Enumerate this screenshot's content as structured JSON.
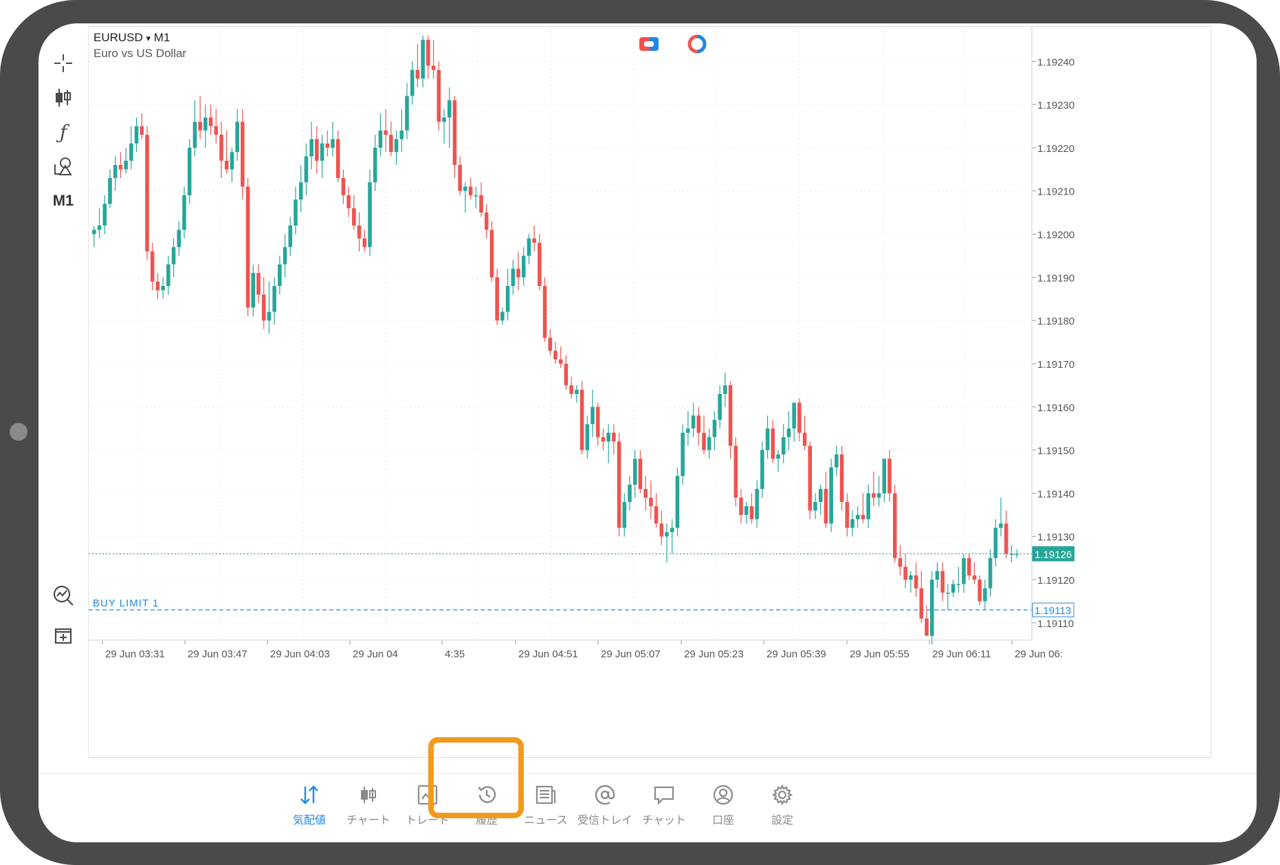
{
  "symbol": {
    "name": "EURUSD",
    "dropdown": "▾",
    "timeframe": "M1",
    "description": "Euro vs US Dollar"
  },
  "left_toolbar": {
    "crosshair": "crosshair-icon",
    "chart_type": "candlestick-icon",
    "indicators": "function-icon",
    "objects": "shapes-icon",
    "timeframe_label": "M1",
    "trade_chart": "trade-chart-icon",
    "add_indicator": "add-window-icon"
  },
  "colors": {
    "bull": "#26a69a",
    "bear": "#ef5350",
    "price_line": "#26a69a",
    "buy_limit": "#1e88e5",
    "accent": "#1e88e5",
    "highlight": "#f39a1c"
  },
  "price_labels": {
    "current": "1.19126",
    "buy_limit": "1.19113",
    "buy_limit_text": "BUY LIMIT 1"
  },
  "y_axis": [
    "1.19240",
    "1.19230",
    "1.19220",
    "1.19210",
    "1.19200",
    "1.19190",
    "1.19180",
    "1.19170",
    "1.19160",
    "1.19150",
    "1.19140",
    "1.19130",
    "1.19120",
    "1.19110"
  ],
  "x_axis": [
    "29 Jun 03:31",
    "29 Jun 03:47",
    "29 Jun 04:03",
    "29 Jun 04",
    "4:35",
    "29 Jun 04:51",
    "29 Jun 05:07",
    "29 Jun 05:23",
    "29 Jun 05:39",
    "29 Jun 05:55",
    "29 Jun 06:11",
    "29 Jun 06:"
  ],
  "chart_data": {
    "type": "candlestick",
    "ylim": [
      1.19106,
      1.19248
    ],
    "current_price": 1.19126,
    "buy_limit_price": 1.19113,
    "candles": [
      [
        1.192,
        1.19202,
        1.19197,
        1.19201
      ],
      [
        1.19201,
        1.19206,
        1.19199,
        1.19202
      ],
      [
        1.19202,
        1.19209,
        1.192,
        1.19207
      ],
      [
        1.19207,
        1.19215,
        1.19206,
        1.19213
      ],
      [
        1.19213,
        1.19218,
        1.1921,
        1.19216
      ],
      [
        1.19216,
        1.19219,
        1.19213,
        1.19215
      ],
      [
        1.19215,
        1.1922,
        1.19214,
        1.19217
      ],
      [
        1.19217,
        1.19225,
        1.19215,
        1.19221
      ],
      [
        1.19221,
        1.19227,
        1.19219,
        1.19225
      ],
      [
        1.19225,
        1.19228,
        1.19222,
        1.19223
      ],
      [
        1.19223,
        1.19225,
        1.19194,
        1.19196
      ],
      [
        1.19196,
        1.19198,
        1.19187,
        1.19189
      ],
      [
        1.19189,
        1.19191,
        1.19185,
        1.19187
      ],
      [
        1.19187,
        1.1919,
        1.19185,
        1.19188
      ],
      [
        1.19188,
        1.19195,
        1.19186,
        1.19193
      ],
      [
        1.19193,
        1.19199,
        1.1919,
        1.19197
      ],
      [
        1.19197,
        1.19203,
        1.19195,
        1.19201
      ],
      [
        1.19201,
        1.19211,
        1.19199,
        1.19209
      ],
      [
        1.19209,
        1.19222,
        1.19207,
        1.1922
      ],
      [
        1.1922,
        1.19231,
        1.19218,
        1.19226
      ],
      [
        1.19226,
        1.19232,
        1.19222,
        1.19224
      ],
      [
        1.19224,
        1.1923,
        1.1922,
        1.19227
      ],
      [
        1.19227,
        1.1923,
        1.19223,
        1.19225
      ],
      [
        1.19225,
        1.19229,
        1.19221,
        1.19223
      ],
      [
        1.19223,
        1.19226,
        1.19213,
        1.19217
      ],
      [
        1.19217,
        1.19224,
        1.19214,
        1.19215
      ],
      [
        1.19215,
        1.1922,
        1.19212,
        1.19219
      ],
      [
        1.19219,
        1.19229,
        1.19217,
        1.19226
      ],
      [
        1.19226,
        1.19229,
        1.19208,
        1.19211
      ],
      [
        1.19211,
        1.19213,
        1.19181,
        1.19183
      ],
      [
        1.19183,
        1.19193,
        1.19181,
        1.19191
      ],
      [
        1.19191,
        1.19193,
        1.19184,
        1.19186
      ],
      [
        1.19186,
        1.1919,
        1.19178,
        1.1918
      ],
      [
        1.1918,
        1.19189,
        1.19177,
        1.19182
      ],
      [
        1.19182,
        1.1919,
        1.19179,
        1.19188
      ],
      [
        1.19188,
        1.19195,
        1.19186,
        1.19193
      ],
      [
        1.19193,
        1.192,
        1.1919,
        1.19197
      ],
      [
        1.19197,
        1.19204,
        1.19195,
        1.19202
      ],
      [
        1.19202,
        1.19211,
        1.192,
        1.19208
      ],
      [
        1.19208,
        1.19216,
        1.19205,
        1.19212
      ],
      [
        1.19212,
        1.19221,
        1.19209,
        1.19218
      ],
      [
        1.19218,
        1.19226,
        1.19215,
        1.19222
      ],
      [
        1.19222,
        1.19225,
        1.19214,
        1.19217
      ],
      [
        1.19217,
        1.19223,
        1.19213,
        1.19221
      ],
      [
        1.19221,
        1.19224,
        1.19218,
        1.1922
      ],
      [
        1.1922,
        1.19226,
        1.19218,
        1.19222
      ],
      [
        1.19222,
        1.19224,
        1.19212,
        1.19213
      ],
      [
        1.19213,
        1.19215,
        1.19207,
        1.19209
      ],
      [
        1.19209,
        1.19211,
        1.19204,
        1.19206
      ],
      [
        1.19206,
        1.19209,
        1.19201,
        1.19202
      ],
      [
        1.19202,
        1.19205,
        1.19196,
        1.19199
      ],
      [
        1.19199,
        1.19201,
        1.19196,
        1.19197
      ],
      [
        1.19197,
        1.19215,
        1.19195,
        1.19212
      ],
      [
        1.19212,
        1.19223,
        1.1921,
        1.1922
      ],
      [
        1.1922,
        1.19228,
        1.19218,
        1.19224
      ],
      [
        1.19224,
        1.19229,
        1.19219,
        1.19223
      ],
      [
        1.19223,
        1.19226,
        1.19218,
        1.19219
      ],
      [
        1.19219,
        1.19224,
        1.19216,
        1.19222
      ],
      [
        1.19222,
        1.19229,
        1.19219,
        1.19224
      ],
      [
        1.19224,
        1.19235,
        1.19222,
        1.19232
      ],
      [
        1.19232,
        1.1924,
        1.1923,
        1.19238
      ],
      [
        1.19238,
        1.19244,
        1.19234,
        1.19236
      ],
      [
        1.19236,
        1.19246,
        1.19234,
        1.19245
      ],
      [
        1.19245,
        1.19246,
        1.19236,
        1.19239
      ],
      [
        1.19239,
        1.19245,
        1.19236,
        1.19238
      ],
      [
        1.19238,
        1.1924,
        1.19224,
        1.19226
      ],
      [
        1.19226,
        1.19229,
        1.19221,
        1.19227
      ],
      [
        1.19227,
        1.19234,
        1.1922,
        1.19231
      ],
      [
        1.19231,
        1.19232,
        1.19213,
        1.19216
      ],
      [
        1.19216,
        1.19218,
        1.19209,
        1.1921
      ],
      [
        1.1921,
        1.19212,
        1.19205,
        1.19211
      ],
      [
        1.19211,
        1.19213,
        1.19208,
        1.19209
      ],
      [
        1.19209,
        1.19211,
        1.19206,
        1.19209
      ],
      [
        1.19209,
        1.19212,
        1.19204,
        1.19205
      ],
      [
        1.19205,
        1.19207,
        1.19199,
        1.19201
      ],
      [
        1.19201,
        1.19203,
        1.19189,
        1.1919
      ],
      [
        1.1919,
        1.19192,
        1.19179,
        1.1918
      ],
      [
        1.1918,
        1.19183,
        1.19179,
        1.19182
      ],
      [
        1.19182,
        1.19192,
        1.1918,
        1.19188
      ],
      [
        1.19188,
        1.19194,
        1.19186,
        1.19192
      ],
      [
        1.19192,
        1.19196,
        1.19187,
        1.1919
      ],
      [
        1.1919,
        1.19197,
        1.19188,
        1.19195
      ],
      [
        1.19195,
        1.192,
        1.19193,
        1.19199
      ],
      [
        1.19199,
        1.19202,
        1.19196,
        1.19198
      ],
      [
        1.19198,
        1.192,
        1.19187,
        1.19188
      ],
      [
        1.19188,
        1.1919,
        1.19175,
        1.19176
      ],
      [
        1.19176,
        1.19178,
        1.19172,
        1.19173
      ],
      [
        1.19173,
        1.19175,
        1.1917,
        1.19171
      ],
      [
        1.19171,
        1.19174,
        1.19169,
        1.1917
      ],
      [
        1.1917,
        1.19172,
        1.19164,
        1.19165
      ],
      [
        1.19165,
        1.19167,
        1.19162,
        1.19163
      ],
      [
        1.19163,
        1.19165,
        1.19161,
        1.19164
      ],
      [
        1.19164,
        1.19166,
        1.19149,
        1.1915
      ],
      [
        1.1915,
        1.19158,
        1.19148,
        1.19156
      ],
      [
        1.19156,
        1.19164,
        1.19153,
        1.1916
      ],
      [
        1.1916,
        1.19161,
        1.19151,
        1.19153
      ],
      [
        1.19153,
        1.19155,
        1.1915,
        1.19152
      ],
      [
        1.19152,
        1.19156,
        1.19147,
        1.19154
      ],
      [
        1.19154,
        1.19156,
        1.19149,
        1.19152
      ],
      [
        1.19152,
        1.19154,
        1.1913,
        1.19132
      ],
      [
        1.19132,
        1.1914,
        1.1913,
        1.19138
      ],
      [
        1.19138,
        1.19144,
        1.19136,
        1.19142
      ],
      [
        1.19142,
        1.1915,
        1.19139,
        1.19148
      ],
      [
        1.19148,
        1.1915,
        1.1914,
        1.19141
      ],
      [
        1.19141,
        1.19144,
        1.19136,
        1.19139
      ],
      [
        1.19139,
        1.19143,
        1.19134,
        1.19137
      ],
      [
        1.19137,
        1.1914,
        1.19132,
        1.19133
      ],
      [
        1.19133,
        1.19136,
        1.19128,
        1.1913
      ],
      [
        1.1913,
        1.19133,
        1.19124,
        1.19131
      ],
      [
        1.19131,
        1.19134,
        1.19126,
        1.19132
      ],
      [
        1.19132,
        1.19146,
        1.1913,
        1.19144
      ],
      [
        1.19144,
        1.19156,
        1.19142,
        1.19154
      ],
      [
        1.19154,
        1.19159,
        1.19151,
        1.19155
      ],
      [
        1.19155,
        1.19161,
        1.19153,
        1.19158
      ],
      [
        1.19158,
        1.1916,
        1.19151,
        1.19154
      ],
      [
        1.19154,
        1.19158,
        1.19149,
        1.1915
      ],
      [
        1.1915,
        1.19155,
        1.19148,
        1.19153
      ],
      [
        1.19153,
        1.19159,
        1.1915,
        1.19157
      ],
      [
        1.19157,
        1.19165,
        1.19155,
        1.19163
      ],
      [
        1.19163,
        1.19168,
        1.1916,
        1.19165
      ],
      [
        1.19165,
        1.19166,
        1.19148,
        1.19151
      ],
      [
        1.19151,
        1.19153,
        1.19137,
        1.19139
      ],
      [
        1.19139,
        1.19141,
        1.19133,
        1.19135
      ],
      [
        1.19135,
        1.19138,
        1.19133,
        1.19137
      ],
      [
        1.19137,
        1.1914,
        1.19133,
        1.19134
      ],
      [
        1.19134,
        1.19143,
        1.19132,
        1.19141
      ],
      [
        1.19141,
        1.19152,
        1.19139,
        1.1915
      ],
      [
        1.1915,
        1.19158,
        1.19148,
        1.19155
      ],
      [
        1.19155,
        1.19157,
        1.19147,
        1.19148
      ],
      [
        1.19148,
        1.1915,
        1.19145,
        1.19149
      ],
      [
        1.19149,
        1.19156,
        1.19147,
        1.19153
      ],
      [
        1.19153,
        1.19159,
        1.1915,
        1.19155
      ],
      [
        1.19155,
        1.19161,
        1.19152,
        1.19161
      ],
      [
        1.19161,
        1.19162,
        1.19152,
        1.19154
      ],
      [
        1.19154,
        1.19158,
        1.1915,
        1.19151
      ],
      [
        1.19151,
        1.19152,
        1.19134,
        1.19136
      ],
      [
        1.19136,
        1.1914,
        1.19134,
        1.19138
      ],
      [
        1.19138,
        1.19142,
        1.19135,
        1.19141
      ],
      [
        1.19141,
        1.19145,
        1.19132,
        1.19133
      ],
      [
        1.19133,
        1.19148,
        1.19131,
        1.19146
      ],
      [
        1.19146,
        1.19151,
        1.19144,
        1.19149
      ],
      [
        1.19149,
        1.19151,
        1.19136,
        1.19138
      ],
      [
        1.19138,
        1.1914,
        1.1913,
        1.19132
      ],
      [
        1.19132,
        1.19136,
        1.1913,
        1.19134
      ],
      [
        1.19134,
        1.19137,
        1.19132,
        1.19135
      ],
      [
        1.19135,
        1.1914,
        1.19133,
        1.19134
      ],
      [
        1.19134,
        1.19142,
        1.19132,
        1.1914
      ],
      [
        1.1914,
        1.19145,
        1.19137,
        1.19139
      ],
      [
        1.19139,
        1.19144,
        1.19137,
        1.1914
      ],
      [
        1.1914,
        1.19148,
        1.19138,
        1.19148
      ],
      [
        1.19148,
        1.1915,
        1.19138,
        1.1914
      ],
      [
        1.1914,
        1.19142,
        1.19124,
        1.19125
      ],
      [
        1.19125,
        1.19128,
        1.19121,
        1.19123
      ],
      [
        1.19123,
        1.19126,
        1.19118,
        1.1912
      ],
      [
        1.1912,
        1.19122,
        1.19117,
        1.19121
      ],
      [
        1.19121,
        1.19124,
        1.19116,
        1.19118
      ],
      [
        1.19118,
        1.19122,
        1.1911,
        1.19111
      ],
      [
        1.19111,
        1.19114,
        1.19108,
        1.19107
      ],
      [
        1.19107,
        1.19122,
        1.19105,
        1.1912
      ],
      [
        1.1912,
        1.19124,
        1.19118,
        1.19122
      ],
      [
        1.19122,
        1.19124,
        1.19115,
        1.19117
      ],
      [
        1.19117,
        1.19119,
        1.19113,
        1.19117
      ],
      [
        1.19117,
        1.1912,
        1.19116,
        1.19119
      ],
      [
        1.19119,
        1.19123,
        1.19117,
        1.19119
      ],
      [
        1.19119,
        1.19126,
        1.19117,
        1.19125
      ],
      [
        1.19125,
        1.19126,
        1.1912,
        1.19121
      ],
      [
        1.19121,
        1.19124,
        1.19119,
        1.1912
      ],
      [
        1.1912,
        1.19121,
        1.19114,
        1.19115
      ],
      [
        1.19115,
        1.1912,
        1.19113,
        1.19118
      ],
      [
        1.19118,
        1.19127,
        1.19116,
        1.19125
      ],
      [
        1.19125,
        1.19134,
        1.19123,
        1.19132
      ],
      [
        1.19132,
        1.19139,
        1.1913,
        1.19133
      ],
      [
        1.19133,
        1.19136,
        1.19125,
        1.19126
      ],
      [
        1.19126,
        1.19128,
        1.19124,
        1.19126
      ],
      [
        1.19126,
        1.19127,
        1.19125,
        1.19126
      ]
    ]
  },
  "bottom_nav": [
    {
      "label": "気配値",
      "icon": "quotes-icon",
      "active": true
    },
    {
      "label": "チャート",
      "icon": "chart-icon",
      "active": false
    },
    {
      "label": "トレード",
      "icon": "trade-icon",
      "active": false
    },
    {
      "label": "履歴",
      "icon": "history-icon",
      "active": false
    },
    {
      "label": "ニュース",
      "icon": "news-icon",
      "active": false
    },
    {
      "label": "受信トレイ",
      "icon": "mailbox-icon",
      "active": false
    },
    {
      "label": "チャット",
      "icon": "chat-icon",
      "active": false
    },
    {
      "label": "口座",
      "icon": "account-icon",
      "active": false
    },
    {
      "label": "設定",
      "icon": "settings-icon",
      "active": false
    }
  ]
}
